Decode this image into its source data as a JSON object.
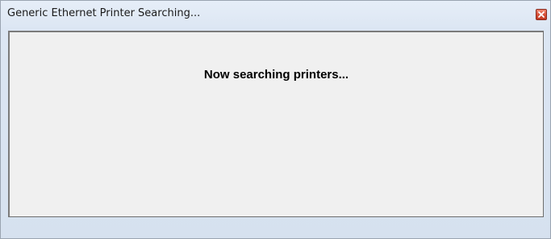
{
  "window": {
    "title": "Generic Ethernet Printer Searching...",
    "close_icon": "close-icon"
  },
  "content": {
    "status_text": "Now searching printers..."
  },
  "colors": {
    "client_background": "#f0f0f0",
    "close_button": "#d8523a"
  }
}
